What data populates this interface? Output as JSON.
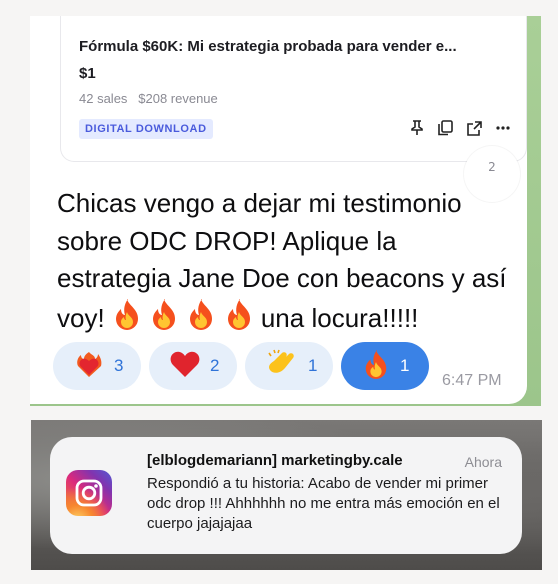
{
  "message_card": {
    "product": {
      "title": "Fórmula $60K: Mi estrategia probada para vender e...",
      "price": "$1",
      "stats": "42 sales   $208 revenue",
      "badge": "DIGITAL DOWNLOAD",
      "actions": [
        "pin-icon",
        "copy-icon",
        "external-link-icon",
        "more-icon"
      ]
    },
    "scroll_badge": "2",
    "text_part1": "Chicas vengo a dejar mi testimonio sobre ODC DROP! Aplique la estrategia Jane Doe con beacons y así voy! ",
    "text_part2": " una locura!!!!!",
    "reactions": [
      {
        "emoji": "heart-on-fire",
        "count": "3",
        "active": false
      },
      {
        "emoji": "red-heart",
        "count": "2",
        "active": false
      },
      {
        "emoji": "clapping-hands",
        "count": "1",
        "active": false
      },
      {
        "emoji": "fire",
        "count": "1",
        "active": true
      }
    ],
    "time": "6:47 PM"
  },
  "notification": {
    "app_icon": "instagram-icon",
    "title": "[elblogdemariann] marketingby.cale",
    "time": "Ahora",
    "body": "Respondió a tu historia: Acabo de vender mi primer odc drop !!! Ahhhhhh no me entra más emoción en el cuerpo jajajajaa"
  },
  "colors": {
    "chat_wallpaper": "#9fc58e",
    "reaction_bg": "#e6effa",
    "reaction_active": "#3a82e6",
    "badge_bg": "#e4eaff",
    "badge_text": "#4a5bdc"
  }
}
